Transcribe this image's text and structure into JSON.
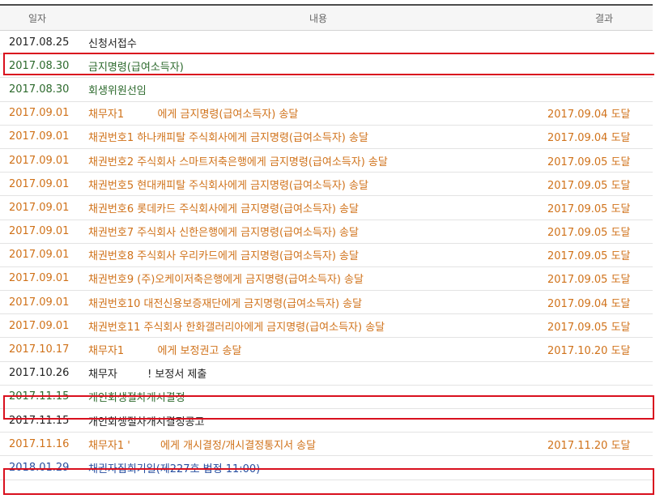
{
  "header": {
    "date": "일자",
    "content": "내용",
    "result": "결과"
  },
  "rows": [
    {
      "date": "2017.08.25",
      "content": "신청서접수",
      "result": "",
      "color": "black"
    },
    {
      "date": "2017.08.30",
      "content": "금지명령(급여소득자)",
      "result": "",
      "color": "green"
    },
    {
      "date": "2017.08.30",
      "content": "회생위원선임",
      "result": "",
      "color": "green"
    },
    {
      "date": "2017.09.01",
      "content": "채무자1          에게 금지명령(급여소득자) 송달",
      "result": "2017.09.04 도달",
      "color": "orange"
    },
    {
      "date": "2017.09.01",
      "content": "채권번호1 하나캐피탈 주식회사에게 금지명령(급여소득자) 송달",
      "result": "2017.09.04 도달",
      "color": "orange"
    },
    {
      "date": "2017.09.01",
      "content": "채권번호2 주식회사 스마트저축은행에게 금지명령(급여소득자) 송달",
      "result": "2017.09.05 도달",
      "color": "orange"
    },
    {
      "date": "2017.09.01",
      "content": "채권번호5 현대캐피탈 주식회사에게 금지명령(급여소득자) 송달",
      "result": "2017.09.05 도달",
      "color": "orange"
    },
    {
      "date": "2017.09.01",
      "content": "채권번호6 롯데카드 주식회사에게 금지명령(급여소득자) 송달",
      "result": "2017.09.05 도달",
      "color": "orange"
    },
    {
      "date": "2017.09.01",
      "content": "채권번호7 주식회사 신한은행에게 금지명령(급여소득자) 송달",
      "result": "2017.09.05 도달",
      "color": "orange"
    },
    {
      "date": "2017.09.01",
      "content": "채권번호8 주식회사 우리카드에게 금지명령(급여소득자) 송달",
      "result": "2017.09.05 도달",
      "color": "orange"
    },
    {
      "date": "2017.09.01",
      "content": "채권번호9 (주)오케이저축은행에게 금지명령(급여소득자) 송달",
      "result": "2017.09.05 도달",
      "color": "orange"
    },
    {
      "date": "2017.09.01",
      "content": "채권번호10 대전신용보증재단에게 금지명령(급여소득자) 송달",
      "result": "2017.09.04 도달",
      "color": "orange"
    },
    {
      "date": "2017.09.01",
      "content": "채권번호11 주식회사 한화갤러리아에게 금지명령(급여소득자) 송달",
      "result": "2017.09.05 도달",
      "color": "orange"
    },
    {
      "date": "2017.10.17",
      "content": "채무자1          에게 보정권고 송달",
      "result": "2017.10.20 도달",
      "color": "orange"
    },
    {
      "date": "2017.10.26",
      "content": "채무자         ! 보정서 제출",
      "result": "",
      "color": "black"
    },
    {
      "date": "2017.11.15",
      "content": "개인회생절차개시결정",
      "result": "",
      "color": "green"
    },
    {
      "date": "2017.11.15",
      "content": "개인회생절차개시결정공고",
      "result": "",
      "color": "black"
    },
    {
      "date": "2017.11.16",
      "content": "채무자1 '         에게 개시결정/개시결정통지서 송달",
      "result": "2017.11.20 도달",
      "color": "orange"
    },
    {
      "date": "2018.01.29",
      "content": "채권자집회기일(제227호 법정 11:00)",
      "result": "",
      "color": "blue"
    }
  ],
  "highlight_color": "#d9101e"
}
